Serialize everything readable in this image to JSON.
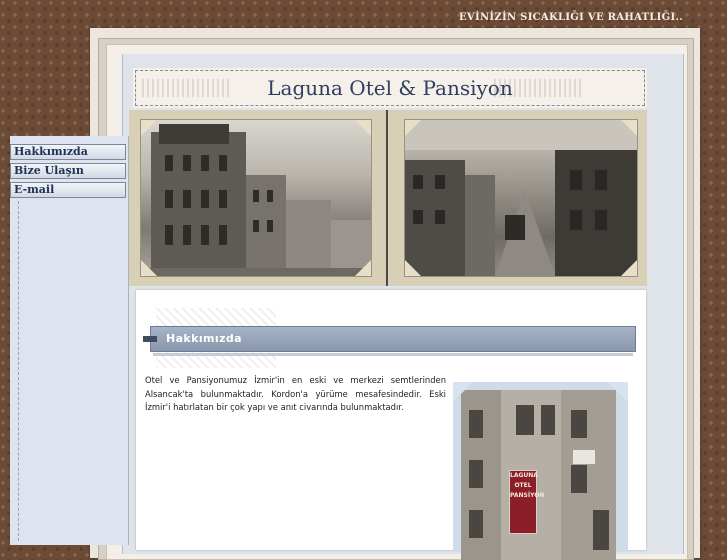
{
  "header": {
    "tagline": "EVİNİZİN SICAKLIĞI VE RAHATLIĞI..",
    "site_title": "Laguna Otel & Pansiyon"
  },
  "sidebar": {
    "items": [
      {
        "label": "Hakkımızda"
      },
      {
        "label": "Bize Ulaşın"
      },
      {
        "label": "E-mail"
      }
    ]
  },
  "main": {
    "section_title": "Hakkımızda",
    "about_text": "Otel ve Pansiyonumuz İzmir'in en eski ve merkezi semtlerinden Alsancak'ta bulunmaktadır. Kordon'a yürüme mesafesindedir. Eski İzmir'i hatırlatan bir çok yapı ve anıt civarında bulunmaktadır.",
    "hotel_sign": [
      "LAGUNA",
      "OTEL",
      "PANSİYON"
    ]
  },
  "colors": {
    "background": "#6b4a36",
    "title_text": "#2f3e5e",
    "nav_text": "#203356",
    "section_bar": "#8997ad",
    "sign_red": "#8b1e28"
  },
  "icons": {
    "section_marker": "section-marker-icon"
  }
}
